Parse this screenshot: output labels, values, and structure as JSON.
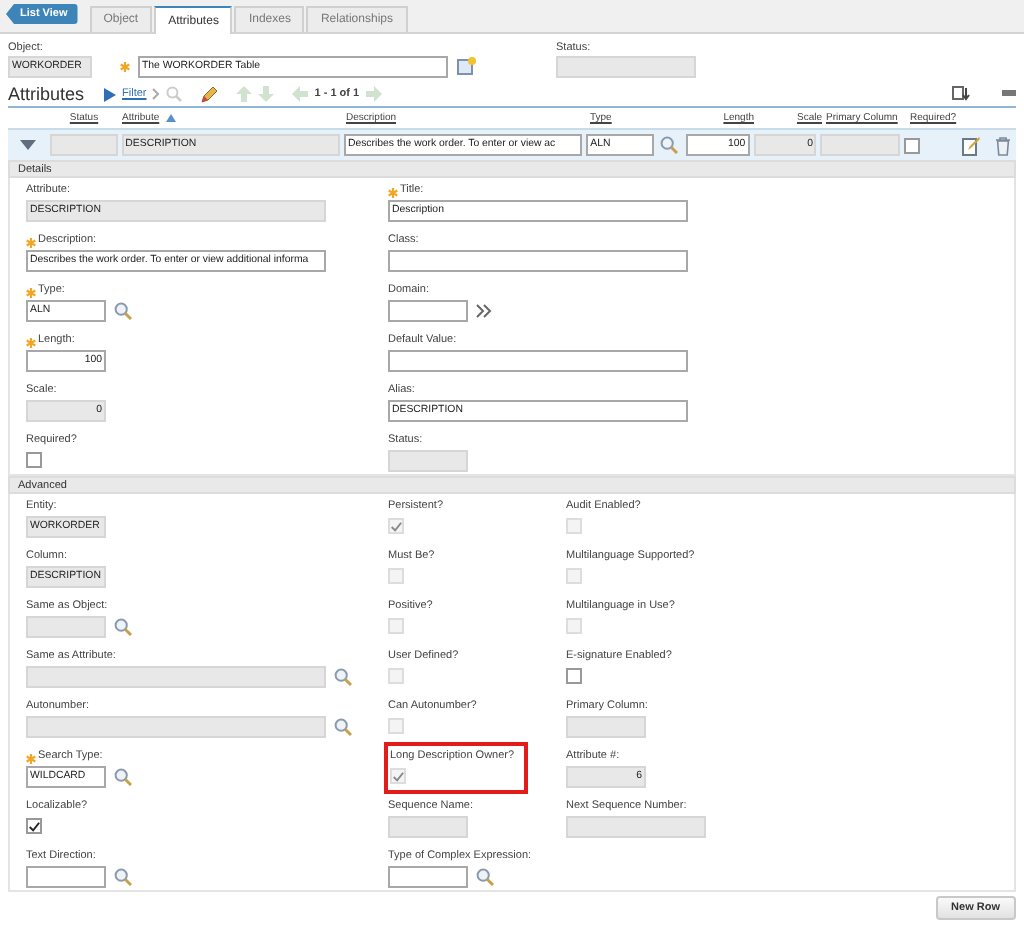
{
  "list_view_button": "List View",
  "tabs": [
    {
      "label": "Object",
      "selected": false
    },
    {
      "label": "Attributes",
      "selected": true
    },
    {
      "label": "Indexes",
      "selected": false
    },
    {
      "label": "Relationships",
      "selected": false
    }
  ],
  "header": {
    "object_label": "Object:",
    "object_value": "WORKORDER",
    "object_description": "The WORKORDER Table",
    "description_required": true,
    "status_label": "Status:"
  },
  "attributes_toolbar": {
    "title": "Attributes",
    "filter": "Filter",
    "pagination": "1 - 1 of 1"
  },
  "table": {
    "columns": [
      {
        "label": "Status",
        "sorted": false
      },
      {
        "label": "Attribute",
        "sorted": true
      },
      {
        "label": "Description",
        "sorted": false
      },
      {
        "label": "Type",
        "sorted": false
      },
      {
        "label": "Length",
        "sorted": false
      },
      {
        "label": "Scale",
        "sorted": false
      },
      {
        "label": "Primary Column",
        "sorted": false
      },
      {
        "label": "Required?",
        "sorted": false
      }
    ],
    "rows": [
      {
        "status": "",
        "attribute": "DESCRIPTION",
        "description": "Describes the work order. To enter or view ac",
        "type": "ALN",
        "length": "100",
        "scale": "0",
        "primary_column": "",
        "required": false
      }
    ]
  },
  "details": {
    "title": "Details",
    "columns": [
      [
        {
          "kind": "long-field",
          "label": "Attribute:",
          "value": "DESCRIPTION",
          "readonly": true,
          "required": false
        },
        {
          "kind": "long-field",
          "label": "Description:",
          "required": true,
          "value": "Describes the work order. To enter or view additional informa",
          "readonly": false
        },
        {
          "kind": "short-field",
          "label": "Type:",
          "required": true,
          "value": "ALN",
          "readonly": false,
          "lookup": {
            "kind": "search"
          }
        },
        {
          "kind": "short-number",
          "label": "Length:",
          "required": true,
          "value": "100",
          "readonly": false
        },
        {
          "kind": "short-number",
          "label": "Scale:",
          "value": "0",
          "readonly": true,
          "required": false
        },
        {
          "kind": "check",
          "label": "Required?",
          "checked": false,
          "disabled": false
        }
      ],
      [
        {
          "kind": "long-field",
          "label": "Title:",
          "required": true,
          "value": "Description",
          "readonly": false
        },
        {
          "kind": "long-field",
          "label": "Class:",
          "readonly": false,
          "required": false
        },
        {
          "kind": "short-field",
          "label": "Domain:",
          "readonly": false,
          "required": false,
          "lookup": {
            "kind": "chevron"
          }
        },
        {
          "kind": "long-field",
          "label": "Default Value:",
          "readonly": false,
          "required": false
        },
        {
          "kind": "long-field",
          "label": "Alias:",
          "value": "DESCRIPTION",
          "readonly": false,
          "required": false
        },
        {
          "kind": "short-field",
          "label": "Status:",
          "readonly": true,
          "required": false
        }
      ]
    ]
  },
  "advanced": {
    "title": "Advanced",
    "columns": [
      [
        {
          "kind": "short-field",
          "label": "Entity:",
          "value": "WORKORDER",
          "readonly": true,
          "required": false
        },
        {
          "kind": "short-field",
          "label": "Column:",
          "value": "DESCRIPTION",
          "readonly": true,
          "required": false
        },
        {
          "kind": "short-field",
          "label": "Same as Object:",
          "readonly": true,
          "required": false,
          "lookup": {
            "kind": "search"
          }
        },
        {
          "kind": "long-field",
          "label": "Same as Attribute:",
          "readonly": true,
          "required": false,
          "lookup": {
            "kind": "search"
          }
        },
        {
          "kind": "long-field",
          "label": "Autonumber:",
          "readonly": true,
          "required": false,
          "lookup": {
            "kind": "search"
          }
        },
        {
          "kind": "short-field",
          "label": "Search Type:",
          "required": true,
          "value": "WILDCARD",
          "readonly": false,
          "lookup": {
            "kind": "search"
          }
        },
        {
          "kind": "check",
          "label": "Localizable?",
          "checked": true,
          "disabled": false
        },
        {
          "kind": "short-field",
          "label": "Text Direction:",
          "readonly": false,
          "required": false,
          "lookup": {
            "kind": "search"
          }
        }
      ],
      [
        {
          "kind": "check",
          "label": "Persistent?",
          "checked": true,
          "disabled": true
        },
        {
          "kind": "check",
          "label": "Must Be?",
          "checked": false,
          "disabled": true
        },
        {
          "kind": "check",
          "label": "Positive?",
          "checked": false,
          "disabled": true
        },
        {
          "kind": "check",
          "label": "User Defined?",
          "checked": false,
          "disabled": true
        },
        {
          "kind": "check",
          "label": "Can Autonumber?",
          "checked": false,
          "disabled": true
        },
        {
          "kind": "check",
          "label": "Long Description Owner?",
          "checked": true,
          "disabled": true,
          "highlighted": true
        },
        {
          "kind": "short-field",
          "label": "Sequence Name:",
          "readonly": true,
          "required": false
        },
        {
          "kind": "short-field",
          "label": "Type of Complex Expression:",
          "readonly": false,
          "required": false,
          "lookup": {
            "kind": "search"
          }
        }
      ],
      [
        {
          "kind": "check",
          "label": "Audit Enabled?",
          "checked": false,
          "disabled": true
        },
        {
          "kind": "check",
          "label": "Multilanguage Supported?",
          "checked": false,
          "disabled": true
        },
        {
          "kind": "check",
          "label": "Multilanguage in Use?",
          "checked": false,
          "disabled": true
        },
        {
          "kind": "check",
          "label": "E-signature Enabled?",
          "checked": false,
          "disabled": false
        },
        {
          "kind": "short-field",
          "label": "Primary Column:",
          "readonly": true,
          "required": false
        },
        {
          "kind": "short-number",
          "label": "Attribute #:",
          "value": "6",
          "readonly": true,
          "required": false
        },
        {
          "kind": "medium-field",
          "label": "Next Sequence Number:",
          "readonly": true,
          "required": false
        }
      ]
    ]
  },
  "new_row_button": "New Row"
}
